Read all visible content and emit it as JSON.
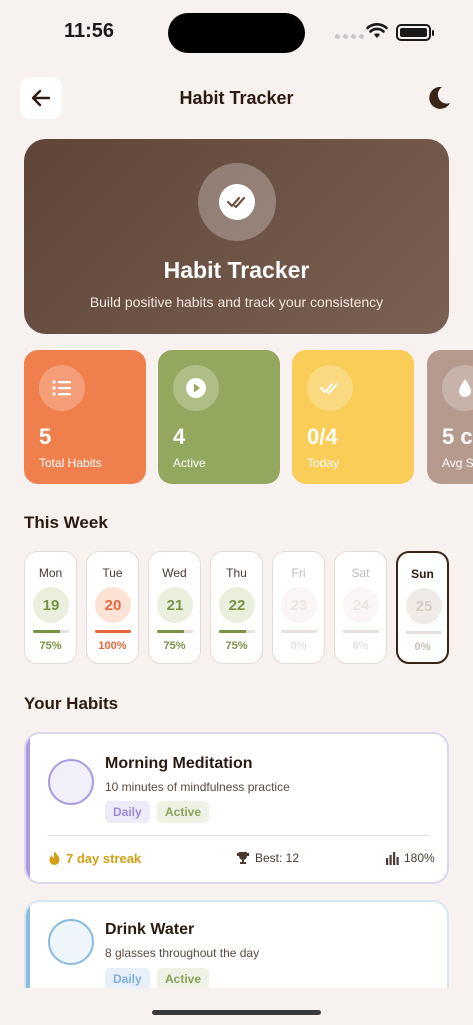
{
  "status": {
    "time": "11:56"
  },
  "header": {
    "title": "Habit Tracker"
  },
  "hero": {
    "title": "Habit Tracker",
    "subtitle": "Build positive habits and track your consistency"
  },
  "stats": [
    {
      "value": "5",
      "label": "Total Habits",
      "color": "#f07f4e",
      "icon": "list-icon"
    },
    {
      "value": "4",
      "label": "Active",
      "color": "#93a85e",
      "icon": "play-icon"
    },
    {
      "value": "0/4",
      "label": "Today",
      "color": "#f9cd57",
      "icon": "double-check-icon"
    },
    {
      "value": "5 c",
      "label": "Avg S",
      "color": "#b59a8d",
      "icon": "drop-icon"
    }
  ],
  "week": {
    "title": "This Week",
    "days": [
      {
        "name": "Mon",
        "date": "19",
        "percent": "75%",
        "progress": 0.75
      },
      {
        "name": "Tue",
        "date": "20",
        "percent": "100%",
        "progress": 1.0
      },
      {
        "name": "Wed",
        "date": "21",
        "percent": "75%",
        "progress": 0.75
      },
      {
        "name": "Thu",
        "date": "22",
        "percent": "75%",
        "progress": 0.75
      },
      {
        "name": "Fri",
        "date": "23",
        "percent": "0%",
        "progress": 0
      },
      {
        "name": "Sat",
        "date": "24",
        "percent": "0%",
        "progress": 0
      },
      {
        "name": "Sun",
        "date": "25",
        "percent": "0%",
        "progress": 0
      }
    ]
  },
  "habits": {
    "title": "Your Habits",
    "items": [
      {
        "name": "Morning Meditation",
        "description": "10 minutes of mindfulness practice",
        "frequency": "Daily",
        "status": "Active",
        "streak": "7 day streak",
        "best": "Best: 12",
        "rate": "180%",
        "accent": "#a99be0"
      },
      {
        "name": "Drink Water",
        "description": "8 glasses throughout the day",
        "frequency": "Daily",
        "status": "Active",
        "accent": "#8cbbe0"
      }
    ]
  }
}
